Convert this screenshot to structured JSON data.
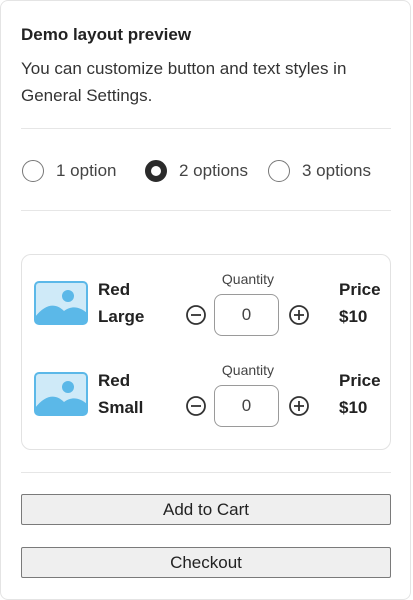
{
  "header": {
    "title": "Demo layout preview",
    "description": "You can customize button and text styles in General Settings."
  },
  "options": [
    {
      "label": "1 option",
      "selected": false
    },
    {
      "label": "2 options",
      "selected": true
    },
    {
      "label": "3 options",
      "selected": false
    }
  ],
  "products": [
    {
      "name_line1": "Red",
      "name_line2": "Large",
      "quantity_label": "Quantity",
      "quantity": "0",
      "price_label": "Price",
      "price": "$10",
      "image_icon": "image-placeholder-icon"
    },
    {
      "name_line1": "Red",
      "name_line2": "Small",
      "quantity_label": "Quantity",
      "quantity": "0",
      "price_label": "Price",
      "price": "$10",
      "image_icon": "image-placeholder-icon"
    }
  ],
  "actions": {
    "add_to_cart": "Add to Cart",
    "checkout": "Checkout"
  },
  "colors": {
    "image_sky": "#5bb8e8",
    "image_light": "#cfeaf8",
    "radio_selected": "#2b2b2b"
  }
}
